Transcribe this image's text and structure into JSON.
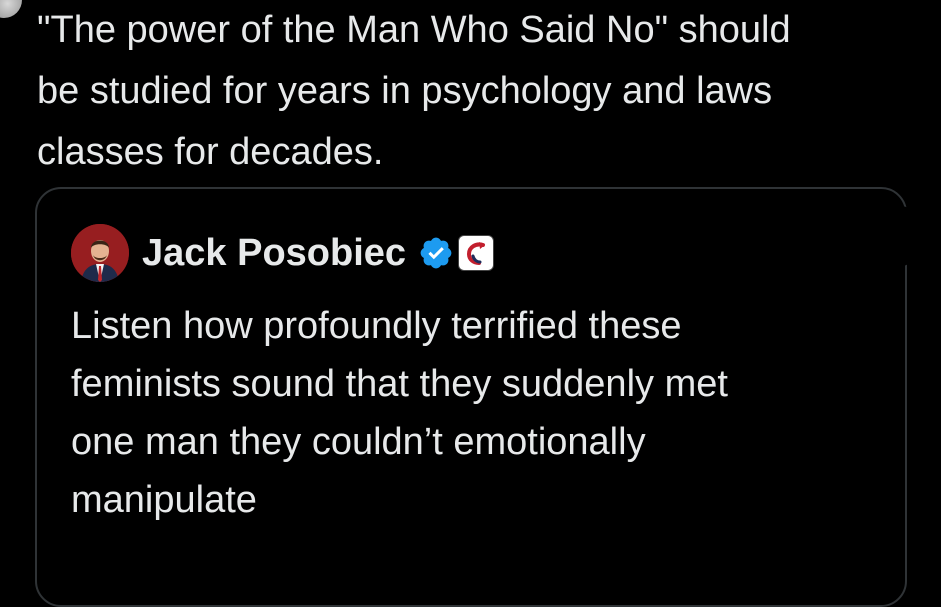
{
  "tweet": {
    "text": "\"The power of the Man Who Said No\" should\nbe studied for years in psychology and laws\nclasses for decades."
  },
  "quote": {
    "author_name": "Jack Posobiec",
    "verified_icon": "verified-badge-icon",
    "affiliate_icon": "affiliate-badge-icon",
    "text": "Listen how profoundly terrified these\nfeminists sound that they suddenly met\none man they couldn’t emotionally\nmanipulate"
  },
  "colors": {
    "background": "#000000",
    "text": "#e7e9ea",
    "border": "#2f3336",
    "verified": "#1d9bf0"
  }
}
